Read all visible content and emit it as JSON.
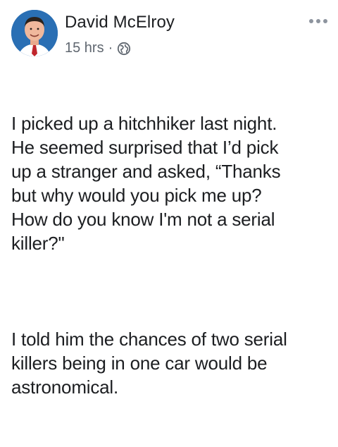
{
  "post": {
    "author": "David McElroy",
    "timestamp": "15 hrs",
    "separator": "·",
    "privacy_icon": "globe-icon",
    "more_icon": "more-options-icon",
    "paragraphs": [
      "I picked up a hitchhiker last night.\nHe seemed surprised that I’d pick\nup a stranger and asked, “Thanks\nbut why would you pick me up?\nHow do you know I'm not a serial\nkiller?\"",
      "I told him the chances of two serial\nkillers being in one car would be\nastronomical."
    ]
  },
  "colors": {
    "text": "#1c1e21",
    "meta": "#606770",
    "avatar_bg": "#2a6fb4"
  }
}
